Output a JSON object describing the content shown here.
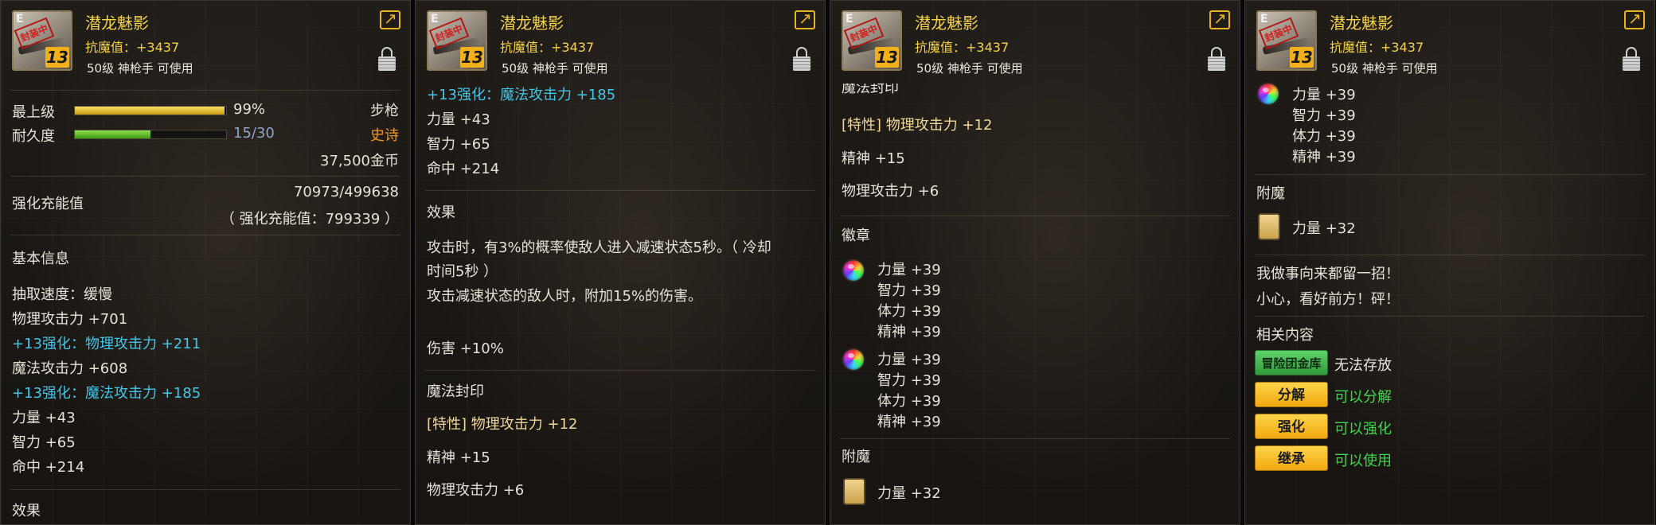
{
  "item": {
    "name": "潜龙魅影",
    "resistance": "抗魔值：+3437",
    "requirement": "50级 神枪手 可使用",
    "icon_grade": "E",
    "icon_seal": "封装中",
    "icon_enhance": "13"
  },
  "colors": {
    "name_gold": "#f4d24a",
    "enhance_cyan": "#43c6e6",
    "epic_orange": "#f0952a",
    "usable_green": "#3ed64a"
  },
  "icons": [
    "item-icon",
    "share-icon",
    "lock-icon",
    "stat-orb-icon",
    "enchant-card-icon"
  ],
  "panel1": {
    "level_label": "最上级",
    "level_value": "99%",
    "level_percent": 99,
    "weapon_type": "步枪",
    "durability_label": "耐久度",
    "durability_value": "15/30",
    "durability_percent": 50,
    "rarity": "史诗",
    "price": "37,500金币",
    "charge_label": "强化充能值",
    "charge_value": "70973/499638",
    "charge_total": "（ 强化充能值：799339 ）",
    "basic_info": "基本信息",
    "lines": [
      {
        "text": "抽取速度：缓慢",
        "cls": ""
      },
      {
        "text": "物理攻击力 +701",
        "cls": ""
      },
      {
        "text": "+13强化：物理攻击力 +211",
        "cls": "hl"
      },
      {
        "text": "魔法攻击力 +608",
        "cls": ""
      },
      {
        "text": "+13强化：魔法攻击力 +185",
        "cls": "hl"
      },
      {
        "text": "力量 +43",
        "cls": ""
      },
      {
        "text": "智力 +65",
        "cls": ""
      },
      {
        "text": "命中 +214",
        "cls": ""
      }
    ],
    "effect_title": "效果"
  },
  "panel2": {
    "lines": [
      {
        "text": "+13强化：魔法攻击力 +185",
        "cls": "hl"
      },
      {
        "text": "力量 +43",
        "cls": ""
      },
      {
        "text": "智力 +65",
        "cls": ""
      },
      {
        "text": "命中 +214",
        "cls": ""
      }
    ],
    "effect_title": "效果",
    "effect_desc_1": "攻击时，有3%的概率使敌人进入减速状态5秒。（ 冷却",
    "effect_desc_2": "时间5秒 ）",
    "effect_desc_3": "攻击减速状态的敌人时，附加15%的伤害。",
    "damage": "伤害 +10%",
    "seal_title": "魔法封印",
    "trait": "[特性] 物理攻击力 +12",
    "spirit": "精神 +15",
    "phys": "物理攻击力 +6"
  },
  "panel3": {
    "seal_title_cut": "魔法封印",
    "trait": "[特性] 物理攻击力 +12",
    "spirit": "精神 +15",
    "phys": "物理攻击力 +6",
    "emblem_title": "徽章",
    "emblems": [
      [
        "力量 +39",
        "智力 +39",
        "体力 +39",
        "精神 +39"
      ],
      [
        "力量 +39",
        "智力 +39",
        "体力 +39",
        "精神 +39"
      ]
    ],
    "enchant_title": "附魔",
    "enchant_value": "力量 +32"
  },
  "panel4": {
    "emblem_stats": [
      "力量 +39",
      "智力 +39",
      "体力 +39",
      "精神 +39"
    ],
    "enchant_title": "附魔",
    "enchant_value": "力量 +32",
    "flavor_1": "我做事向来都留一招！",
    "flavor_2": "小心，看好前方！砰！",
    "related_title": "相关内容",
    "actions": [
      {
        "button": "冒险团金库",
        "status": "无法存放",
        "style": "green",
        "status_cls": "sec"
      },
      {
        "button": "分解",
        "status": "可以分解",
        "style": "gold",
        "status_cls": "green"
      },
      {
        "button": "强化",
        "status": "可以强化",
        "style": "gold",
        "status_cls": "green"
      },
      {
        "button": "继承",
        "status": "可以使用",
        "style": "gold",
        "status_cls": "green"
      }
    ]
  }
}
